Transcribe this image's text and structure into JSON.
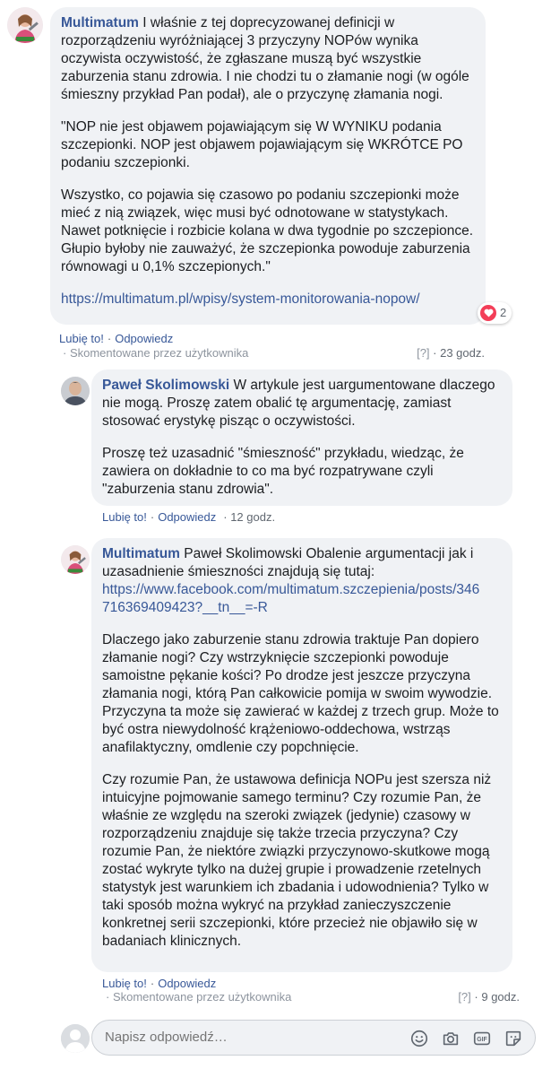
{
  "comments": [
    {
      "author": "Multimatum",
      "paragraphs": [
        "I właśnie z tej doprecyzowanej definicji w rozporządzeniu wyróżniającej 3 przyczyny NOPów wynika oczywista oczywistość, że zgłaszane muszą być wszystkie zaburzenia stanu zdrowia. I nie chodzi tu o złamanie nogi (w ogóle śmieszny przykład Pan podał), ale o przyczynę złamania nogi.",
        "\"NOP nie jest objawem pojawiającym się W WYNIKU podania szczepionki. NOP jest objawem pojawiającym się WKRÓTCE PO podaniu szczepionki.",
        "Wszystko, co pojawia się czasowo po podaniu szczepionki może mieć z nią związek, więc musi być odnotowane w statystykach. Nawet potknięcie i rozbicie kolana w dwa tygodnie po szczepionce. Głupio byłoby nie zauważyć, że szczepionka powoduje zaburzenia równowagi u 0,1% szczepionych.\""
      ],
      "link": "https://multimatum.pl/wpisy/system-monitorowania-nopow/",
      "reaction_count": "2",
      "like": "Lubię to!",
      "reply": "Odpowiedz",
      "commented_by": "· Skomentowane przez użytkownika",
      "help": "[?]",
      "time": "· 23 godz."
    },
    {
      "author": "Paweł Skolimowski",
      "paragraphs": [
        "W artykule jest uargumentowane dlaczego nie mogą. Proszę zatem obalić tę argumentację, zamiast stosować erystykę pisząc o oczywistości.",
        "Proszę też uzasadnić \"śmieszność\" przykładu, wiedząc, że zawiera on dokładnie to co ma być rozpatrywane czyli \"zaburzenia stanu zdrowia\"."
      ],
      "like": "Lubię to!",
      "reply": "Odpowiedz",
      "time": "· 12 godz."
    },
    {
      "author": "Multimatum",
      "intro": "Paweł Skolimowski Obalenie argumentacji jak i uzasadnienie śmieszności znajdują się tutaj:",
      "link_line1": "https://www.facebook.com/multimatum.szczepienia/posts/346",
      "link_line2": "716369409423?__tn__=-R",
      "paragraphs": [
        "Dlaczego jako zaburzenie stanu zdrowia traktuje Pan dopiero złamanie nogi? Czy wstrzyknięcie szczepionki powoduje samoistne pękanie kości? Po drodze jest jeszcze przyczyna złamania nogi, którą Pan całkowicie pomija w swoim wywodzie. Przyczyna ta może się zawierać w każdej z trzech grup. Może to być ostra niewydolność krążeniowo-oddechowa, wstrząs anafilaktyczny, omdlenie czy popchnięcie.",
        "Czy rozumie Pan, że ustawowa definicja NOPu jest szersza niż intuicyjne pojmowanie samego terminu? Czy rozumie Pan, że właśnie ze względu na szeroki związek (jedynie) czasowy w rozporządzeniu znajduje się także trzecia przyczyna? Czy rozumie Pan, że niektóre związki przyczynowo-skutkowe mogą zostać wykryte tylko na dużej grupie i prowadzenie rzetelnych statystyk jest warunkiem ich zbadania i udowodnienia? Tylko w taki sposób można wykryć na przykład zanieczyszczenie konkretnej serii szczepionki, które przecież nie objawiło się w badaniach klinicznych."
      ],
      "like": "Lubię to!",
      "reply": "Odpowiedz",
      "commented_by": "· Skomentowane przez użytkownika",
      "help": "[?]",
      "time": "· 9 godz."
    }
  ],
  "reply_box": {
    "placeholder": "Napisz odpowiedź…",
    "icons": [
      "emoji-icon",
      "camera-icon",
      "gif-icon",
      "sticker-icon"
    ]
  },
  "colors": {
    "link": "#385898",
    "bubble": "#f0f2f5",
    "heart": "#f33e58"
  }
}
